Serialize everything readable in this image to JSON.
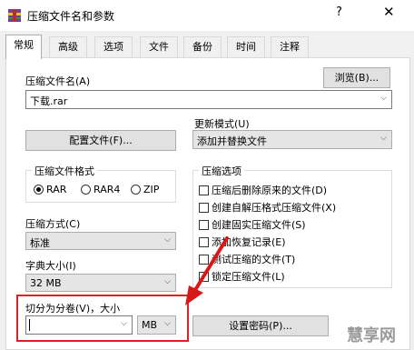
{
  "window": {
    "title": "压缩文件名和参数",
    "help_glyph": "?",
    "close_glyph": "✕"
  },
  "tabs": [
    {
      "label": "常规",
      "active": true
    },
    {
      "label": "高级",
      "active": false
    },
    {
      "label": "选项",
      "active": false
    },
    {
      "label": "文件",
      "active": false
    },
    {
      "label": "备份",
      "active": false
    },
    {
      "label": "时间",
      "active": false
    },
    {
      "label": "注释",
      "active": false
    }
  ],
  "archive": {
    "name_label": "压缩文件名(A)",
    "browse_label": "浏览(B)...",
    "name_value": "下载.rar"
  },
  "profiles": {
    "button_label": "配置文件(F)..."
  },
  "update": {
    "label": "更新模式(U)",
    "value": "添加并替换文件"
  },
  "format": {
    "title": "压缩文件格式",
    "options": [
      {
        "label": "RAR",
        "selected": true
      },
      {
        "label": "RAR4",
        "selected": false
      },
      {
        "label": "ZIP",
        "selected": false
      }
    ]
  },
  "method": {
    "label": "压缩方式(C)",
    "value": "标准"
  },
  "dictionary": {
    "label": "字典大小(I)",
    "value": "32 MB"
  },
  "split": {
    "label": "切分为分卷(V)，大小",
    "value": "",
    "unit": "MB"
  },
  "options": {
    "title": "压缩选项",
    "items": [
      {
        "label": "压缩后删除原来的文件(D)",
        "checked": false
      },
      {
        "label": "创建自解压格式压缩文件(X)",
        "checked": false
      },
      {
        "label": "创建固实压缩文件(S)",
        "checked": false
      },
      {
        "label": "添加恢复记录(E)",
        "checked": false
      },
      {
        "label": "测试压缩的文件(T)",
        "checked": false
      },
      {
        "label": "锁定压缩文件(L)",
        "checked": false
      }
    ]
  },
  "password": {
    "button_label": "设置密码(P)..."
  },
  "watermark": {
    "text": "慧享网"
  },
  "colors": {
    "highlight": "#e02020",
    "arrow": "#d81818"
  }
}
